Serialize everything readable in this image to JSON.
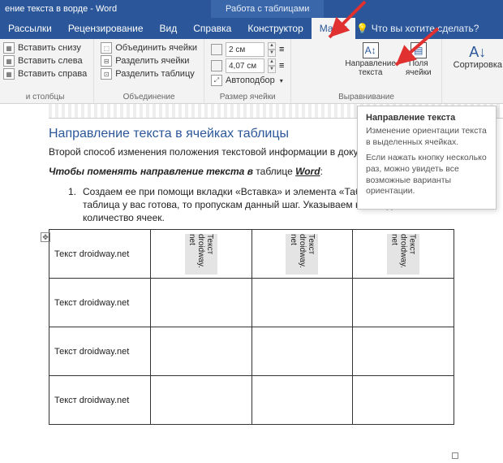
{
  "titlebar": {
    "title": "ение текста в ворде  -  Word",
    "contextual": "Работа с таблицами"
  },
  "tabs": {
    "mailings": "Рассылки",
    "review": "Рецензирование",
    "view": "Вид",
    "help": "Справка",
    "design": "Конструктор",
    "layout": "Макет",
    "tellme": "Что вы хотите сделать?"
  },
  "ribbon": {
    "rows_cols": {
      "insert_below": "Вставить снизу",
      "insert_left": "Вставить слева",
      "insert_right": "Вставить справа",
      "group": "и столбцы"
    },
    "merge": {
      "merge_cells": "Объединить ячейки",
      "split_cells": "Разделить ячейки",
      "split_table": "Разделить таблицу",
      "group": "Объединение"
    },
    "size": {
      "height": "2 см",
      "width": "4,07 см",
      "autofit": "Автоподбор",
      "group": "Размер ячейки"
    },
    "alignment": {
      "text_direction": "Направление текста",
      "cell_margins": "Поля ячейки",
      "group": "Выравнивание"
    },
    "sort": {
      "label": "Сортировка"
    }
  },
  "tooltip": {
    "title": "Направление текста",
    "body1": "Изменение ориентации текста в выделенных ячейках.",
    "body2": "Если нажать кнопку несколько раз, можно увидеть все возможные варианты ориентации."
  },
  "doc": {
    "heading": "Направление текста в ячейках таблицы",
    "para1": "Второй способ изменения положения текстовой информации в докум                          таблицу.",
    "para2_prefix": "Чтобы поменять направление текста в",
    "para2_mid": " таблице ",
    "para2_word": "Word",
    "para2_suffix": ":",
    "list_num": "1.",
    "list_item": "Создаем ее при помощи вкладки «Вставка» и элемента «Таблица», если таблица у вас готова, то пропускам данный шаг. Указываем необходимое количество ячеек.",
    "cell_h": "Текст droidway.net",
    "cell_v": "Текст droidway. net"
  }
}
